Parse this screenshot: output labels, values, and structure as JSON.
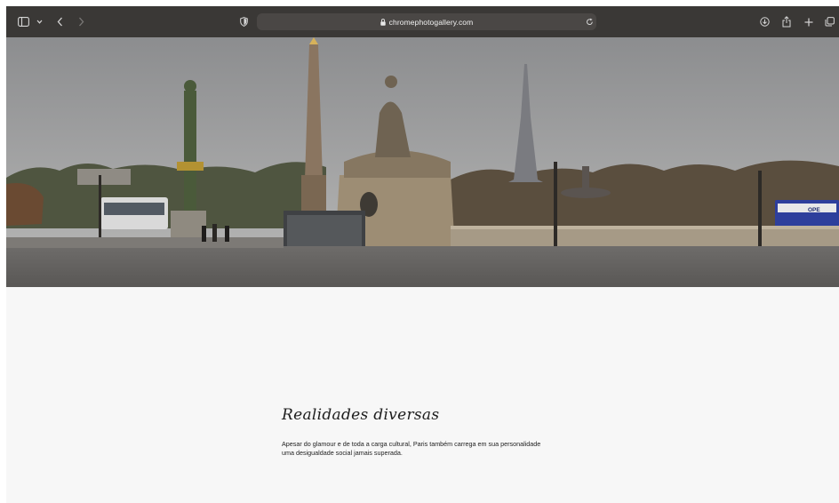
{
  "browser": {
    "url": "chromephotogallery.com",
    "icons": {
      "sidebar": "sidebar-icon",
      "tab_menu": "chevron-down-icon",
      "back": "chevron-left-icon",
      "forward": "chevron-right-icon",
      "privacy": "shield-icon",
      "lock": "lock-icon",
      "reload": "reload-icon",
      "download": "download-icon",
      "share": "share-icon",
      "new_tab": "plus-icon",
      "tabs_overview": "tabs-overview-icon"
    }
  },
  "hero": {
    "bus_sign": "OPE"
  },
  "article": {
    "title": "Realidades diversas",
    "paragraph_line1": "Apesar do glamour e de toda a carga cultural, Paris também carrega em sua personalidade",
    "paragraph_line2": "uma desigualdade social jamais superada."
  },
  "colors": {
    "toolbar": "#3a3836",
    "address_bar": "#4a4745",
    "page_background": "#f7f7f7",
    "text": "#222222"
  }
}
